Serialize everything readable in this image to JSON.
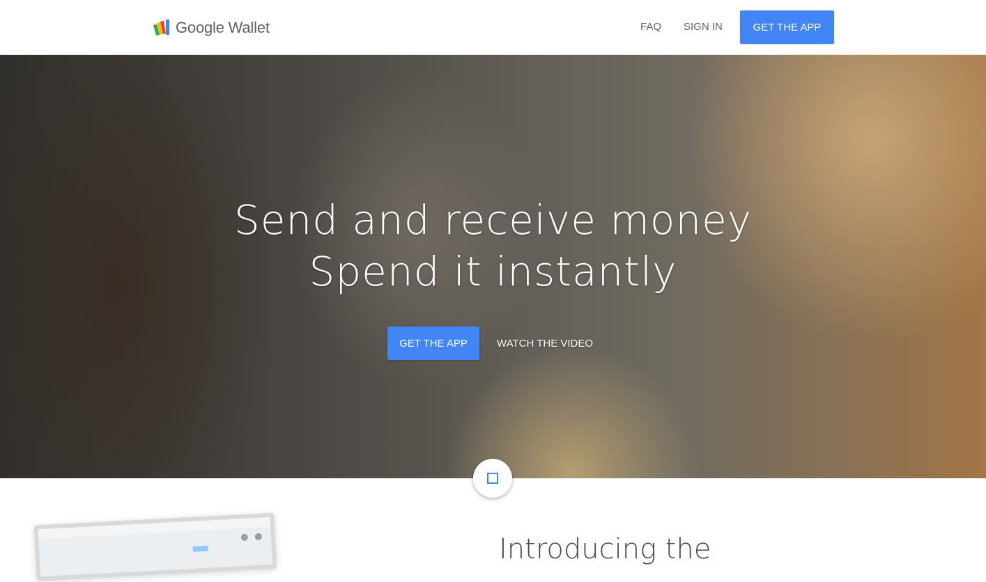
{
  "header": {
    "logo_text": "Google Wallet",
    "nav": {
      "faq": "FAQ",
      "sign_in": "SIGN IN"
    },
    "cta": "GET THE APP"
  },
  "hero": {
    "title_line1": "Send and receive money",
    "title_line2": "Spend it instantly",
    "cta_primary": "GET THE APP",
    "cta_secondary": "WATCH THE VIDEO"
  },
  "scroll_button": {
    "icon": "stop-square-icon"
  },
  "intro": {
    "title": "Introducing the"
  },
  "colors": {
    "accent": "#4285f4",
    "logo_blue": "#4285f4",
    "logo_green": "#34a853",
    "logo_yellow": "#fbbc05",
    "logo_red": "#ea4335"
  }
}
